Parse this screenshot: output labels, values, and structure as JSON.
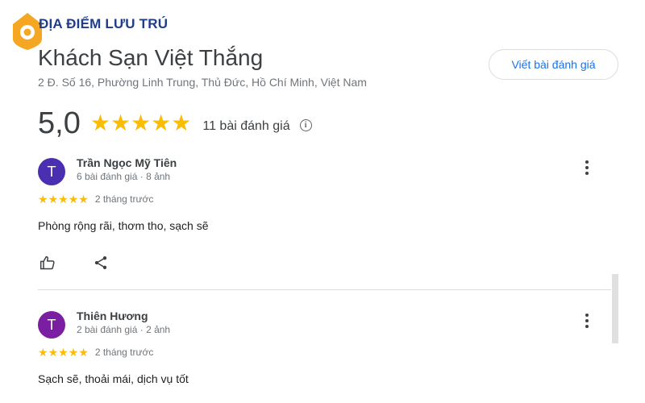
{
  "brand": {
    "name": "ĐỊA ĐIỂM LƯU TRÚ",
    "logo_icon": "location-pin-icon",
    "color": "#f5a623"
  },
  "place": {
    "name": "Khách Sạn Việt Thắng",
    "address": "2 Đ. Số 16, Phường Linh Trung, Thủ Đức, Hồ Chí Minh, Việt Nam"
  },
  "actions": {
    "write_review_label": "Viết bài đánh giá"
  },
  "summary": {
    "rating": "5,0",
    "stars": 5,
    "review_count_label": "11 bài đánh giá",
    "info_icon": "info-icon"
  },
  "reviews": [
    {
      "avatar_letter": "T",
      "avatar_color": "#4a2fb0",
      "name": "Trần Ngọc Mỹ Tiên",
      "meta": "6 bài đánh giá · 8 ảnh",
      "stars": 5,
      "time": "2 tháng trước",
      "text": "Phòng rộng rãi, thơm tho, sạch sẽ"
    },
    {
      "avatar_letter": "T",
      "avatar_color": "#7b1fa2",
      "name": "Thiên Hương",
      "meta": "2 bài đánh giá · 2 ảnh",
      "stars": 5,
      "time": "2 tháng trước",
      "text": "Sạch sẽ, thoải mái, dịch vụ tốt"
    }
  ],
  "colors": {
    "star": "#fbbc04",
    "link": "#1a73e8"
  }
}
